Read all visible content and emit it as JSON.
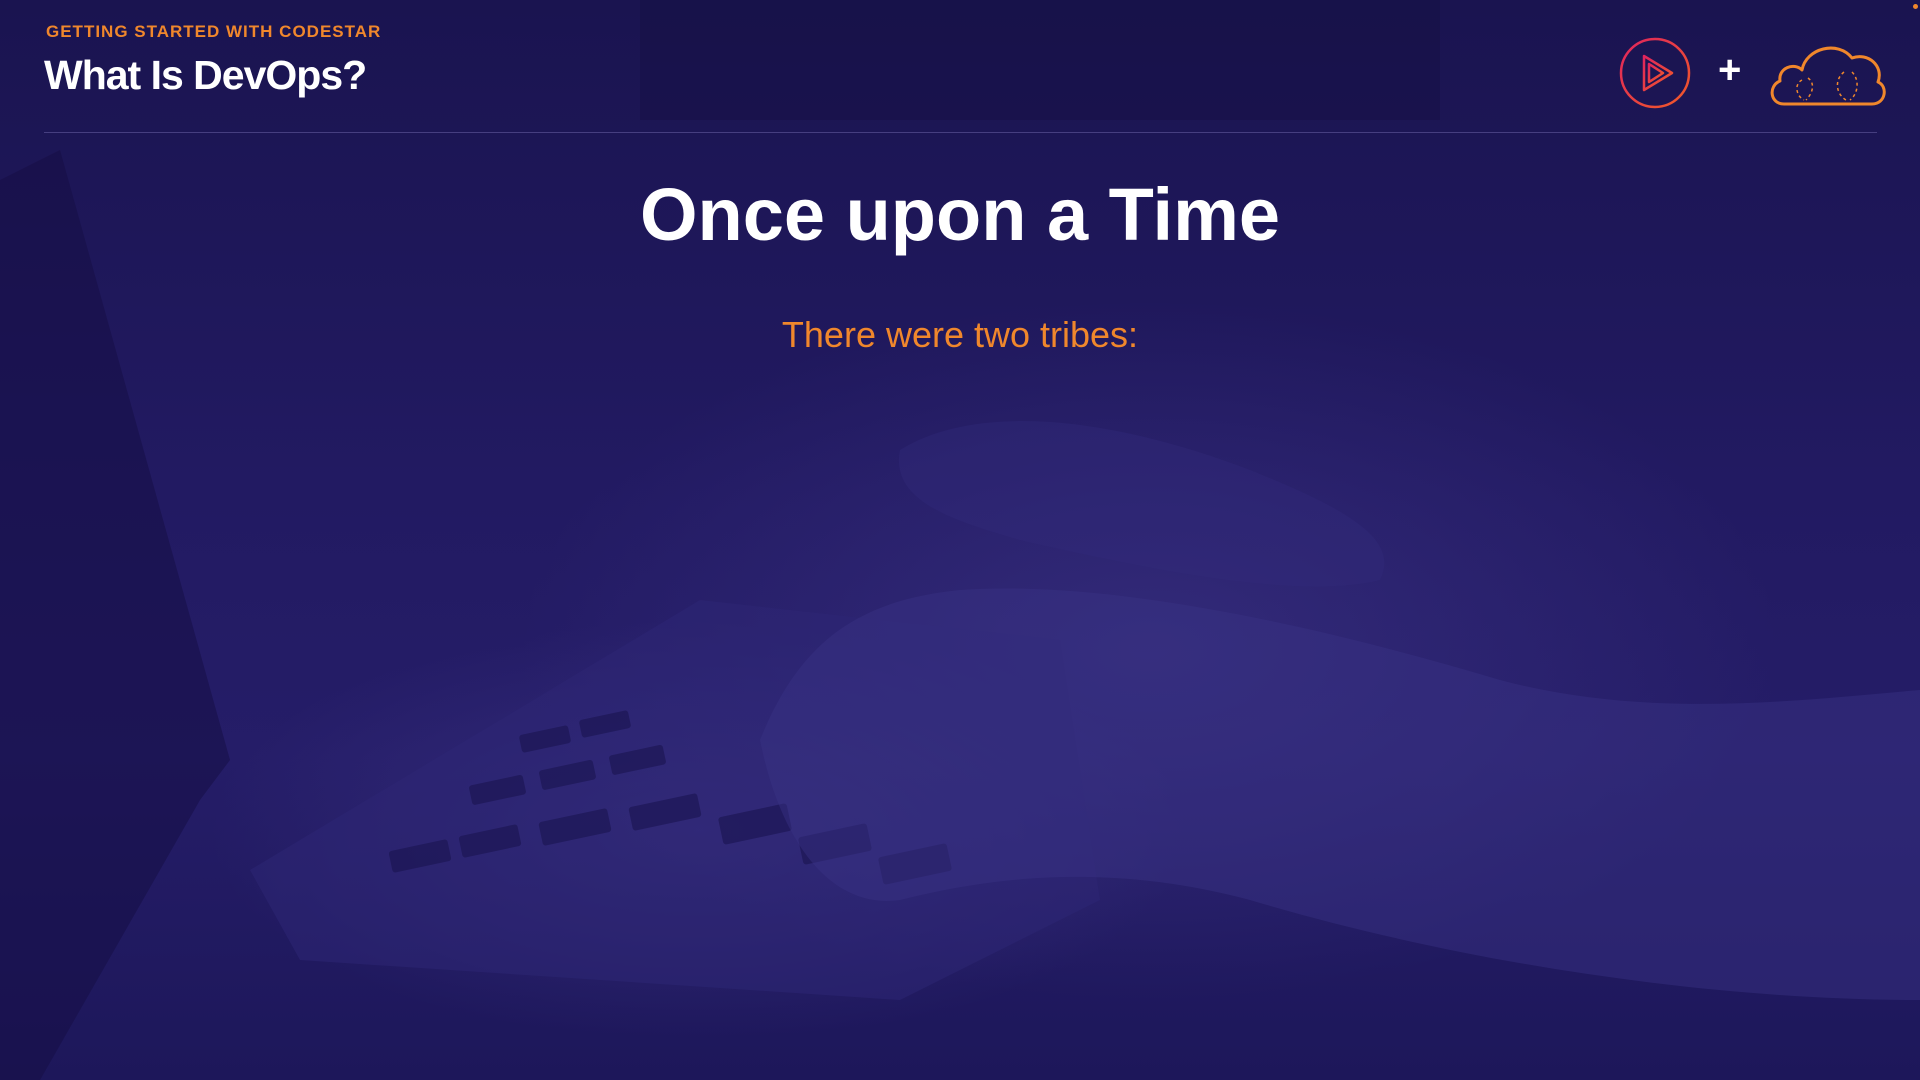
{
  "header": {
    "kicker": "GETTING STARTED WITH CODESTAR",
    "title": "What Is DevOps?"
  },
  "logos": {
    "plus": "+",
    "left_icon": "pluralsight-play-icon",
    "right_icon": "codestar-cloud-icon"
  },
  "slide": {
    "heading": "Once upon a Time",
    "subtitle": "There were two tribes:"
  },
  "colors": {
    "background": "#1b1554",
    "accent_orange": "#f0872c",
    "accent_pink": "#e0245e",
    "text_white": "#ffffff"
  }
}
